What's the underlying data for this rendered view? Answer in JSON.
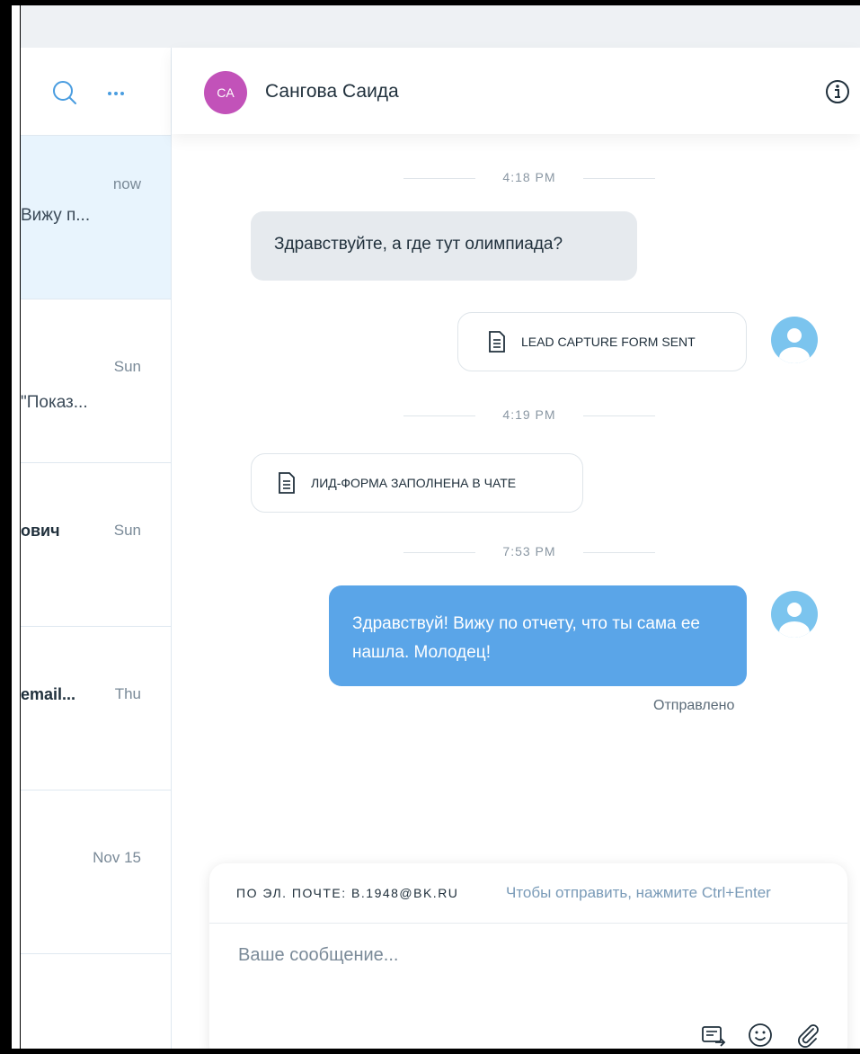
{
  "header": {
    "contact_name": "Сангова Саида",
    "contact_initials": "CA"
  },
  "sidebar": {
    "conversations": [
      {
        "date": "now",
        "preview": "Вижу п...",
        "name": ""
      },
      {
        "date": "Sun",
        "preview": "\"Показ...",
        "name": ""
      },
      {
        "date": "Sun",
        "preview": "",
        "name": "ович"
      },
      {
        "date": "Thu",
        "preview": "",
        "name": "email..."
      },
      {
        "date": "Nov 15",
        "preview": "",
        "name": ""
      }
    ]
  },
  "chat": {
    "timestamps": [
      "4:18 PM",
      "4:19 PM",
      "7:53 PM"
    ],
    "incoming_message": "Здравствуйте, а где тут олимпиада?",
    "form_sent_label": "LEAD CAPTURE FORM SENT",
    "form_filled_label": "ЛИД-ФОРМА ЗАПОЛНЕНА В ЧАТЕ",
    "outgoing_message": "Здравствуй! Вижу по отчету, что ты сама ее нашла. Молодец!",
    "outgoing_status": "Отправлено"
  },
  "composer": {
    "channel_label": "ПО ЭЛ. ПОЧТЕ: B.1948@BK.RU",
    "hint": "Чтобы отправить, нажмите Ctrl+Enter",
    "placeholder": "Ваше сообщение..."
  },
  "colors": {
    "accent": "#5aa5e8",
    "avatar_contact": "#c252b9",
    "avatar_user": "#7bc4ee",
    "active_row": "#e8f4fd"
  }
}
